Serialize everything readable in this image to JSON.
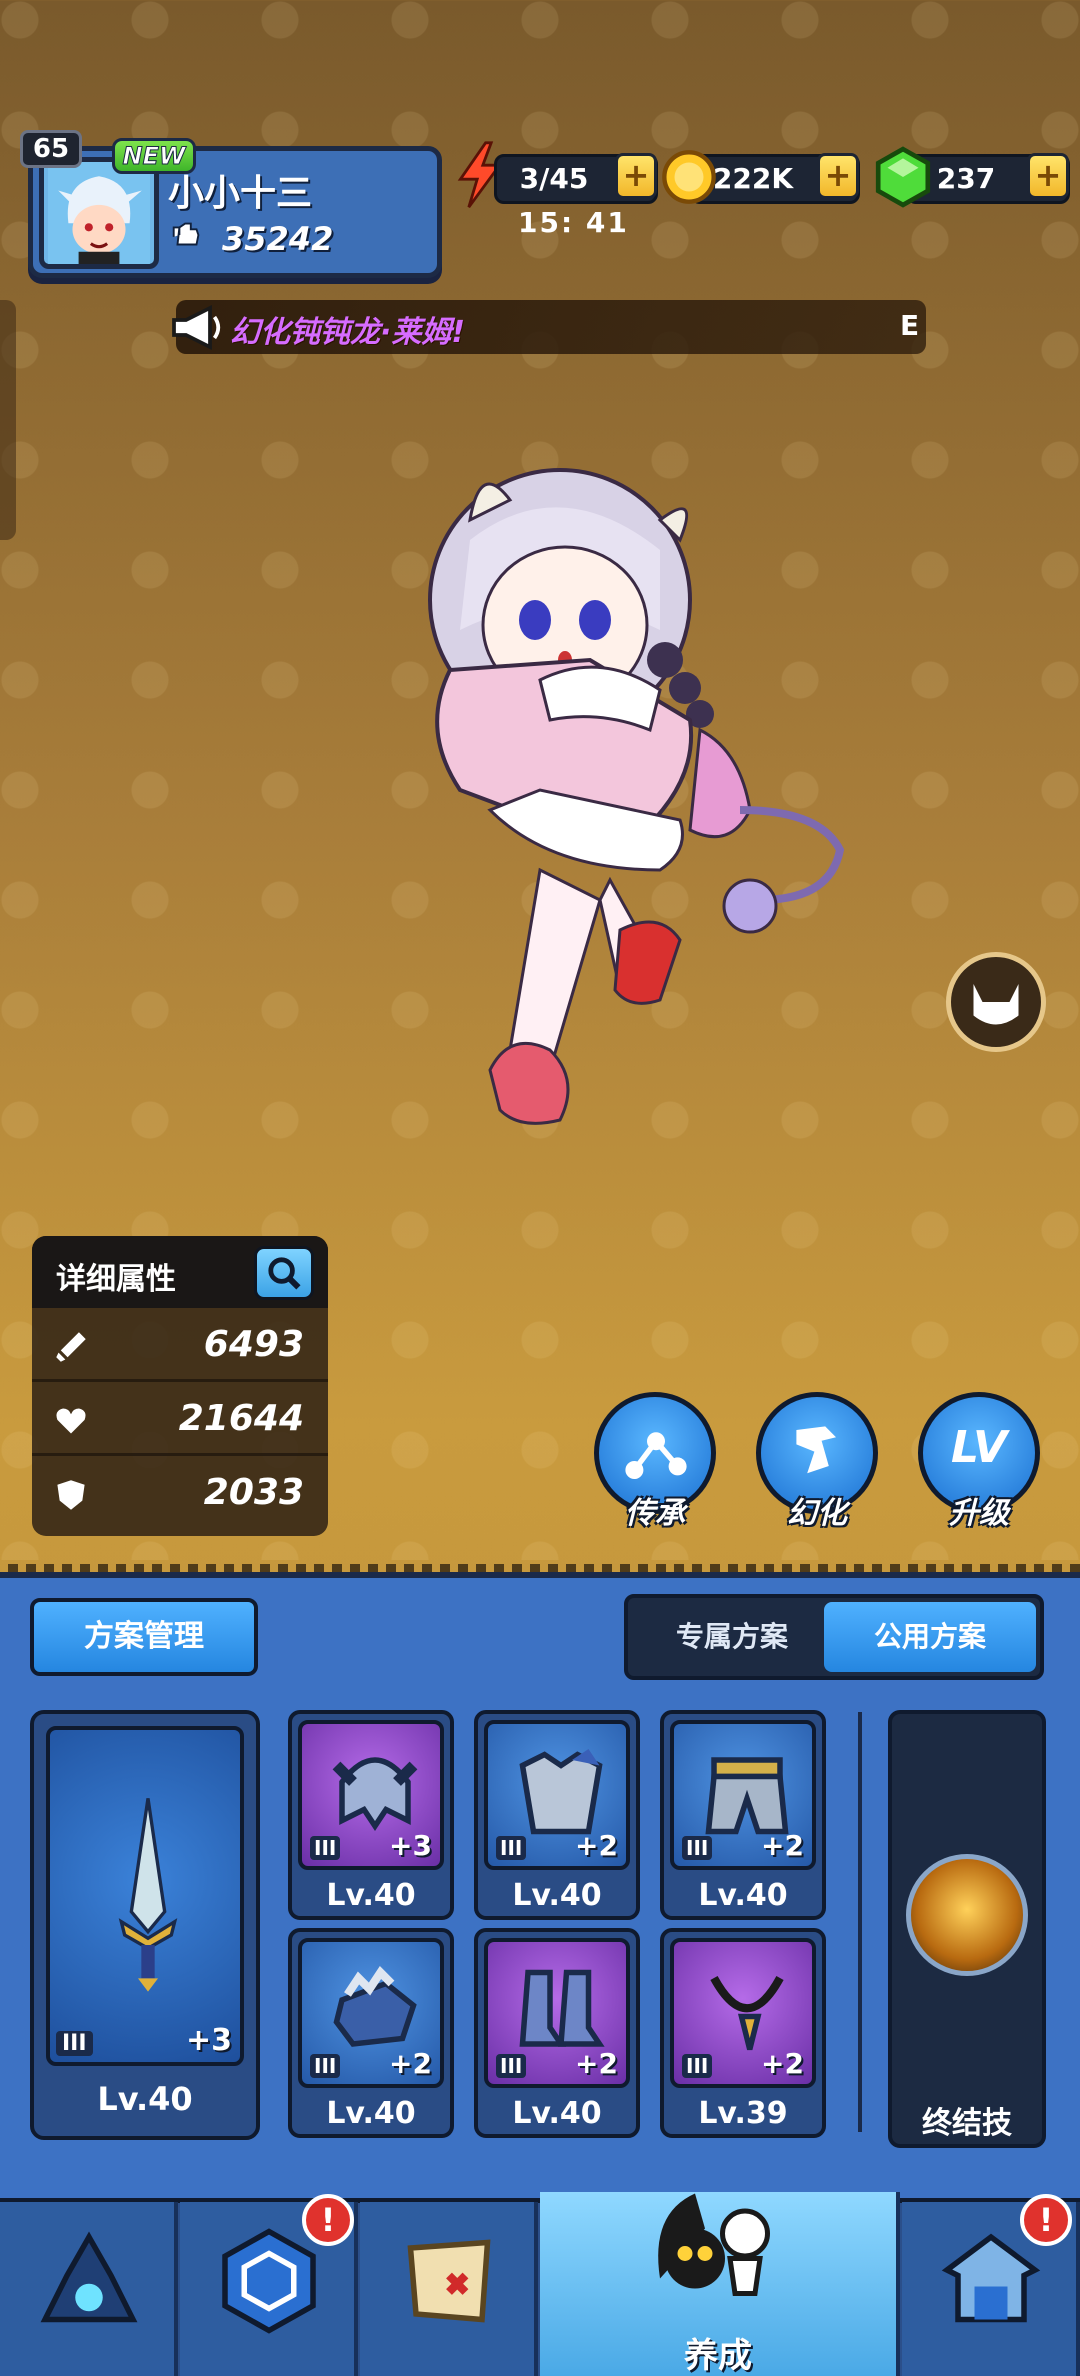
{
  "player": {
    "level": "65",
    "new_badge": "NEW",
    "name": "小小十三",
    "power": "35242"
  },
  "resources": {
    "stamina": "3/45",
    "coins": "222K",
    "gems": "237",
    "plus": "+",
    "timer": "15: 41"
  },
  "announcement": {
    "text": "幻化钝钝龙·莱姆!",
    "tail": "E"
  },
  "stats": {
    "title": "详细属性",
    "attack": "6493",
    "hp": "21644",
    "defense": "2033"
  },
  "actions": {
    "inherit": "传承",
    "transform": "幻化",
    "upgrade": "升级"
  },
  "plans": {
    "manage": "方案管理",
    "exclusive": "专属方案",
    "shared": "公用方案",
    "active": "shared"
  },
  "weapon": {
    "tier": "III",
    "plus": "+3",
    "level": "Lv.40"
  },
  "gear": [
    {
      "icon": "helmet-icon",
      "rarity": "purple",
      "tier": "III",
      "plus": "+3",
      "level": "Lv.40"
    },
    {
      "icon": "armor-icon",
      "rarity": "blue",
      "tier": "III",
      "plus": "+2",
      "level": "Lv.40"
    },
    {
      "icon": "pants-icon",
      "rarity": "blue",
      "tier": "III",
      "plus": "+2",
      "level": "Lv.40"
    },
    {
      "icon": "gloves-icon",
      "rarity": "blue",
      "tier": "III",
      "plus": "+2",
      "level": "Lv.40"
    },
    {
      "icon": "boots-icon",
      "rarity": "purple",
      "tier": "III",
      "plus": "+2",
      "level": "Lv.40"
    },
    {
      "icon": "necklace-icon",
      "rarity": "purple",
      "tier": "III",
      "plus": "+2",
      "level": "Lv.39"
    }
  ],
  "ultimate": {
    "label": "终结技"
  },
  "nav": {
    "tab1": "",
    "tab2": "",
    "tab3": "",
    "tab4": "养成",
    "tab5": "",
    "alert": "!"
  },
  "colors": {
    "panel_blue": "#3d72c4",
    "button_blue": "#2586e0",
    "gold": "#f2b72a",
    "purple_rarity": "#6a2fa6",
    "alert_red": "#e0322d"
  }
}
